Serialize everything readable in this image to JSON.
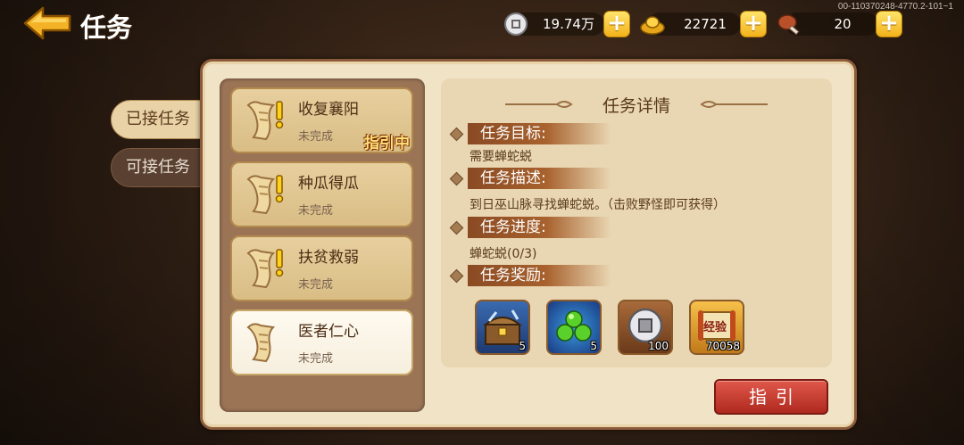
{
  "header": {
    "title": "任务",
    "build_id": "00-110370248-4770.2-101~1"
  },
  "resources": [
    {
      "name": "silver",
      "value": "19.74万",
      "icon": "silver-coin-icon"
    },
    {
      "name": "gold",
      "value": "22721",
      "icon": "gold-ingot-icon"
    },
    {
      "name": "stamina",
      "value": "20",
      "icon": "drumstick-icon"
    }
  ],
  "tabs": {
    "accepted": "已接任务",
    "available": "可接任务"
  },
  "quests": [
    {
      "name": "收复襄阳",
      "status": "未完成",
      "badge": "指引中",
      "icon": "scroll-exclaim-icon"
    },
    {
      "name": "种瓜得瓜",
      "status": "未完成",
      "icon": "scroll-exclaim-icon"
    },
    {
      "name": "扶贫救弱",
      "status": "未完成",
      "icon": "scroll-exclaim-icon"
    },
    {
      "name": "医者仁心",
      "status": "未完成",
      "icon": "scroll-icon"
    }
  ],
  "detail": {
    "title": "任务详情",
    "goal_label": "任务目标:",
    "goal_text": "需要蝉蛇蜕",
    "desc_label": "任务描述:",
    "desc_text": "到日巫山脉寻找蝉蛇蜕。（击败野怪即可获得）",
    "progress_label": "任务进度:",
    "progress_text": "蝉蛇蜕(0/3)",
    "reward_label": "任务奖励:",
    "rewards": [
      {
        "icon": "treasure-chest-icon",
        "qty": "5"
      },
      {
        "icon": "green-pills-icon",
        "qty": "5"
      },
      {
        "icon": "silver-coin-icon",
        "qty": "100"
      },
      {
        "icon": "experience-scroll-icon",
        "qty": "70058",
        "label": "经验"
      }
    ]
  },
  "guide_button": "指引",
  "colors": {
    "accent_gold": "#f2b21a",
    "button_red": "#b0291f",
    "panel_bg": "#f1e3c6",
    "section_bar": "#a8622e"
  }
}
